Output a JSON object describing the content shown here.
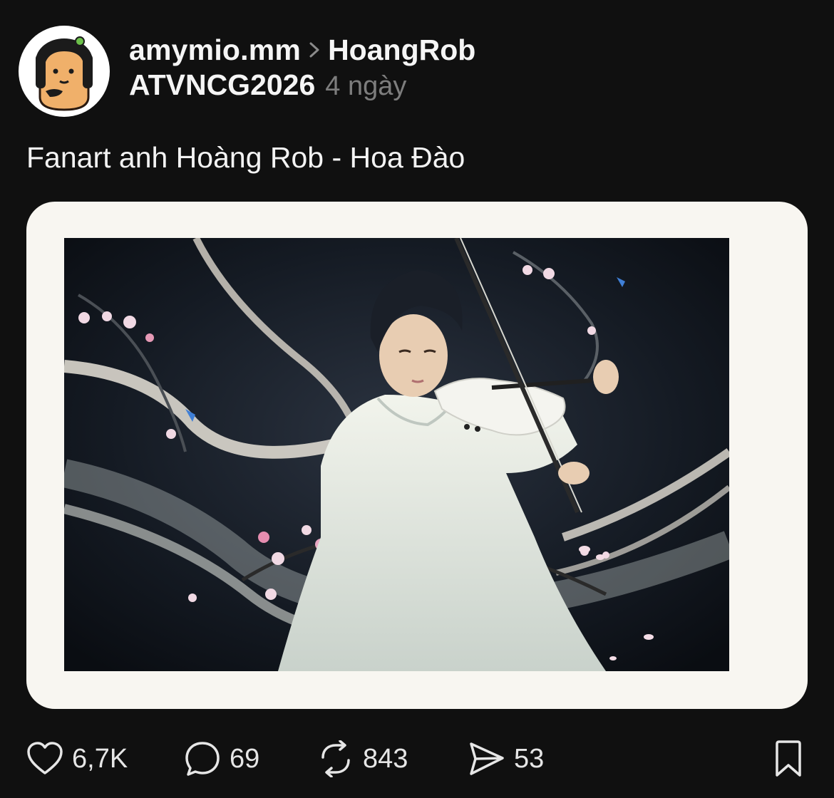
{
  "post": {
    "author": "amymio.mm",
    "reply_to": "HoangRob",
    "topic": "ATVNCG2026",
    "time": "4 ngày",
    "caption": "Fanart anh Hoàng Rob - Hoa Đào"
  },
  "actions": {
    "likes": "6,7K",
    "comments": "69",
    "reposts": "843",
    "shares": "53"
  },
  "icons": {
    "like": "heart-icon",
    "comment": "comment-bubble-icon",
    "repost": "repost-arrows-icon",
    "share": "send-icon",
    "bookmark": "bookmark-icon",
    "breadcrumb": "chevron-right-icon"
  },
  "colors": {
    "background": "#101010",
    "text": "#f3f3f3",
    "muted": "#7d7d7d",
    "media_frame": "#f8f6f1"
  }
}
